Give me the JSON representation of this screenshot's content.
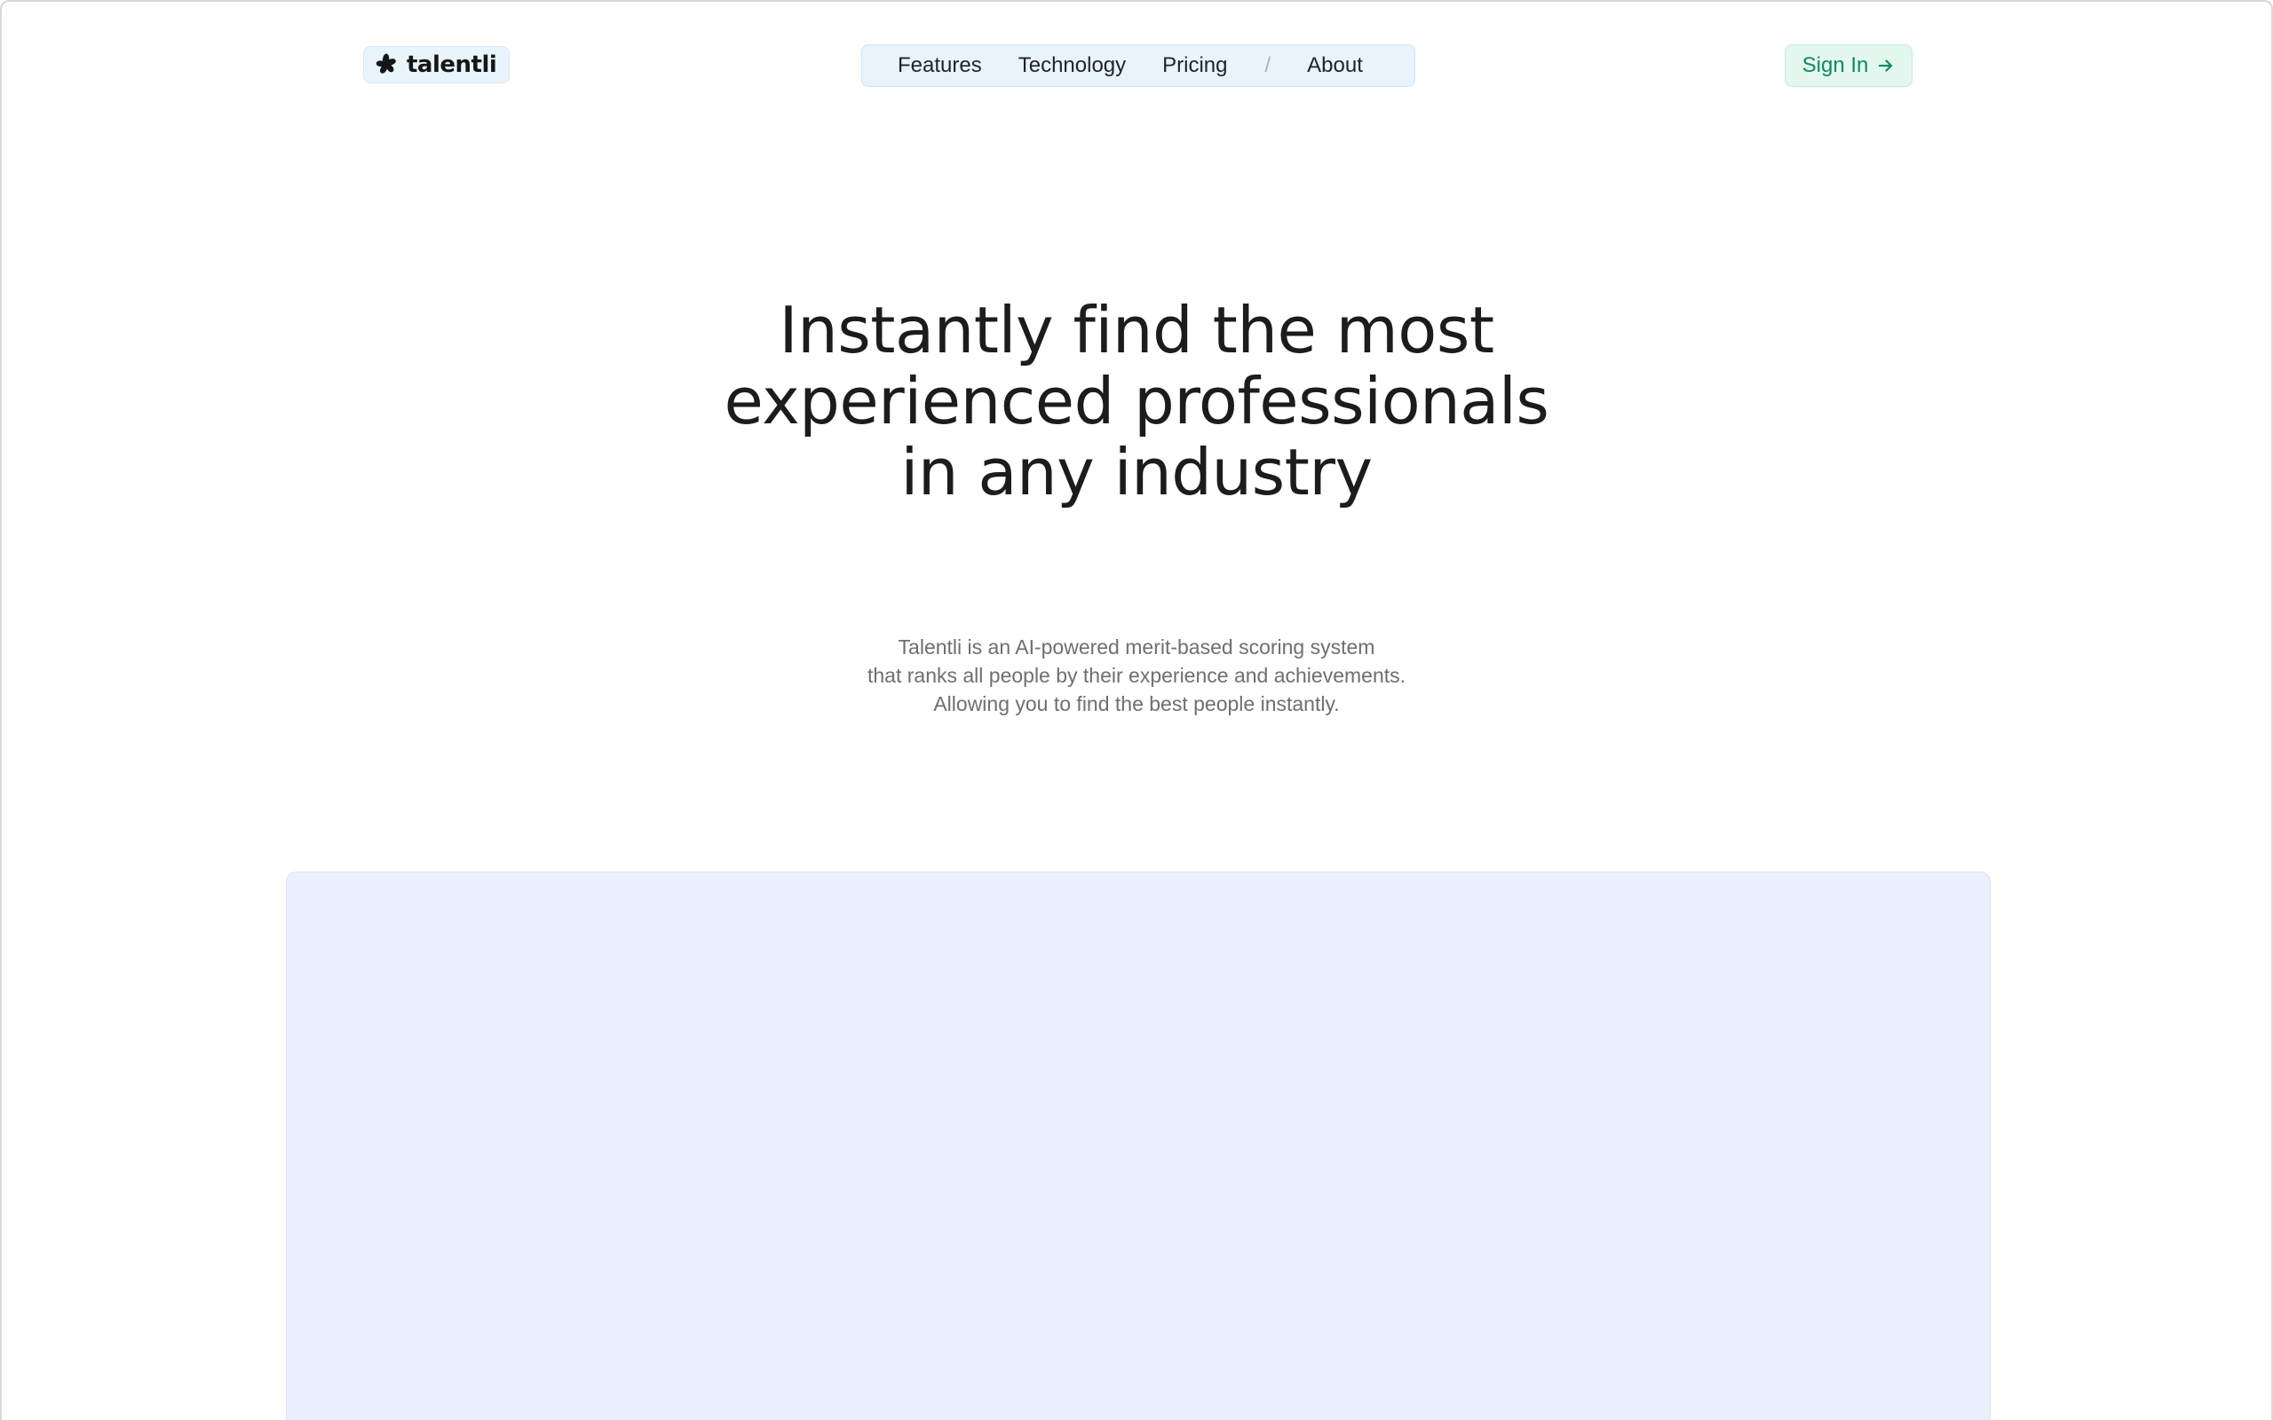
{
  "brand": {
    "name": "talentli",
    "logo_icon": "flower-icon",
    "accent_color": "#0f8a63",
    "nav_bg_color": "#e8f3fc"
  },
  "nav": {
    "items": [
      {
        "label": "Features"
      },
      {
        "label": "Technology"
      },
      {
        "label": "Pricing"
      }
    ],
    "separator": "/",
    "after_separator": {
      "label": "About"
    }
  },
  "header": {
    "signin_label": "Sign In",
    "signin_icon": "arrow-right-icon"
  },
  "hero": {
    "title_lines": [
      "Instantly find the most",
      "experienced professionals",
      "in any industry"
    ],
    "subtitle_lines": [
      "Talentli is an AI-powered merit-based scoring system",
      "that ranks all people by their experience and achievements.",
      "Allowing you to find the best people instantly."
    ]
  },
  "preview": {
    "background_color": "#eceffd"
  }
}
